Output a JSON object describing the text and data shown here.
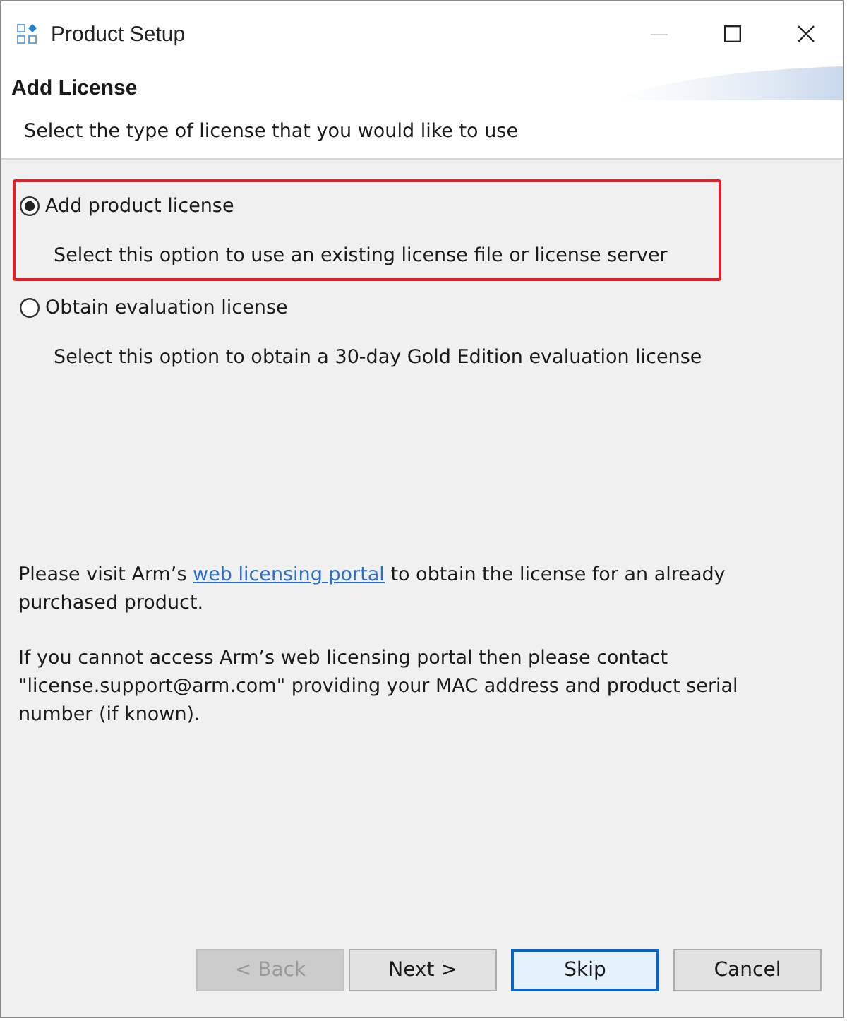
{
  "window": {
    "title": "Product Setup",
    "controls": [
      {
        "kind": "minimize",
        "disabled": true
      },
      {
        "kind": "maximize",
        "disabled": false
      },
      {
        "kind": "close",
        "disabled": false
      }
    ]
  },
  "header": {
    "title": "Add License",
    "subtitle": "Select the type of license that you would like to use"
  },
  "options": [
    {
      "label": "Add product license",
      "description": "Select this option to use an existing license file or license server",
      "selected": true,
      "highlighted": true
    },
    {
      "label": "Obtain evaluation license",
      "description": "Select this option to obtain a 30-day Gold Edition evaluation license",
      "selected": false,
      "highlighted": false
    }
  ],
  "info": [
    {
      "parts": [
        {
          "kind": "text",
          "text": "Please visit Arm’s "
        },
        {
          "kind": "link",
          "text": "web licensing portal"
        },
        {
          "kind": "text",
          "text": " to obtain the license for an already purchased product."
        }
      ]
    },
    {
      "parts": [
        {
          "kind": "text",
          "text": "If you cannot access Arm’s web licensing portal then please contact \"license.support@arm.com\" providing your MAC address and product serial number (if known)."
        }
      ]
    }
  ],
  "buttons": [
    {
      "label": "< Back",
      "disabled": true,
      "focused": false
    },
    {
      "label": "Next >",
      "disabled": false,
      "focused": false
    },
    {
      "label": "Skip",
      "disabled": false,
      "focused": true
    },
    {
      "label": "Cancel",
      "disabled": false,
      "focused": false
    }
  ]
}
